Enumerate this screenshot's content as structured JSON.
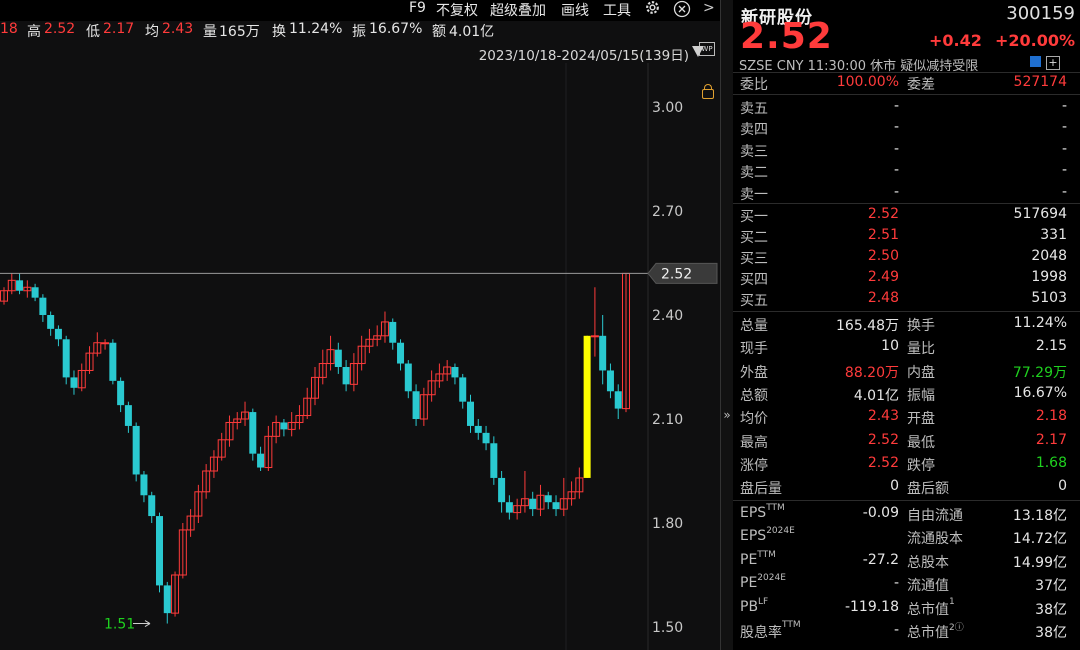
{
  "toolbar": {
    "f9": "F9",
    "adjust": "不复权",
    "overlay": "超级叠加",
    "draw": "画线",
    "tools": "工具",
    "next": ">"
  },
  "stats": {
    "partial_prefix": "18",
    "high_label": "高",
    "high": "2.52",
    "low_label": "低",
    "low": "2.17",
    "avg_label": "均",
    "avg": "2.43",
    "vol_label": "量",
    "vol": "165万",
    "turnover_label": "换",
    "turnover": "11.24%",
    "amplitude_label": "振",
    "amplitude": "16.67%",
    "amount_label": "额",
    "amount": "4.01亿"
  },
  "range_text": "2023/10/18-2024/05/15(139日)",
  "wp_label": "WP",
  "chart_data": {
    "type": "candlestick",
    "y_ticks": [
      3.0,
      2.7,
      2.4,
      2.1,
      1.8,
      1.5
    ],
    "y_tick_labels": [
      "3.00",
      "2.70",
      "2.40",
      "2.10",
      "1.80",
      "1.50"
    ],
    "ylim": [
      1.48,
      3.05
    ],
    "current_price_label": "2.52",
    "current_price": 2.52,
    "min_annotation": "1.51",
    "min_value": 1.51,
    "colors": {
      "up": "#ff3b3b",
      "down": "#2ac9d0",
      "limit_up": "#ffff00",
      "axis_text": "#c8c8c8"
    },
    "candles": [
      [
        2.44,
        2.47,
        2.43,
        2.48
      ],
      [
        2.47,
        2.5,
        2.46,
        2.52
      ],
      [
        2.5,
        2.47,
        2.46,
        2.52
      ],
      [
        2.47,
        2.48,
        2.45,
        2.5
      ],
      [
        2.48,
        2.45,
        2.44,
        2.49
      ],
      [
        2.45,
        2.4,
        2.38,
        2.46
      ],
      [
        2.4,
        2.36,
        2.34,
        2.41
      ],
      [
        2.36,
        2.33,
        2.31,
        2.37
      ],
      [
        2.33,
        2.22,
        2.2,
        2.34
      ],
      [
        2.22,
        2.19,
        2.17,
        2.24
      ],
      [
        2.19,
        2.24,
        2.18,
        2.26
      ],
      [
        2.24,
        2.29,
        2.23,
        2.31
      ],
      [
        2.29,
        2.32,
        2.28,
        2.35
      ],
      [
        2.32,
        2.32,
        2.3,
        2.33
      ],
      [
        2.32,
        2.21,
        2.2,
        2.33
      ],
      [
        2.21,
        2.14,
        2.12,
        2.22
      ],
      [
        2.14,
        2.08,
        2.06,
        2.15
      ],
      [
        2.08,
        1.94,
        1.92,
        2.09
      ],
      [
        1.94,
        1.88,
        1.86,
        1.95
      ],
      [
        1.88,
        1.82,
        1.8,
        1.89
      ],
      [
        1.82,
        1.62,
        1.6,
        1.83
      ],
      [
        1.62,
        1.54,
        1.51,
        1.63
      ],
      [
        1.54,
        1.65,
        1.53,
        1.66
      ],
      [
        1.65,
        1.78,
        1.64,
        1.8
      ],
      [
        1.78,
        1.82,
        1.76,
        1.84
      ],
      [
        1.82,
        1.89,
        1.8,
        1.91
      ],
      [
        1.89,
        1.95,
        1.87,
        1.97
      ],
      [
        1.95,
        1.99,
        1.93,
        2.01
      ],
      [
        1.99,
        2.04,
        1.98,
        2.06
      ],
      [
        2.04,
        2.09,
        2.02,
        2.11
      ],
      [
        2.09,
        2.1,
        2.07,
        2.12
      ],
      [
        2.1,
        2.12,
        2.08,
        2.15
      ],
      [
        2.12,
        2.0,
        1.98,
        2.13
      ],
      [
        2.0,
        1.96,
        1.95,
        2.02
      ],
      [
        1.96,
        2.05,
        1.95,
        2.08
      ],
      [
        2.05,
        2.09,
        2.03,
        2.11
      ],
      [
        2.09,
        2.07,
        2.05,
        2.1
      ],
      [
        2.07,
        2.09,
        2.05,
        2.12
      ],
      [
        2.09,
        2.11,
        2.07,
        2.14
      ],
      [
        2.11,
        2.16,
        2.1,
        2.19
      ],
      [
        2.16,
        2.22,
        2.14,
        2.25
      ],
      [
        2.22,
        2.26,
        2.2,
        2.3
      ],
      [
        2.26,
        2.3,
        2.24,
        2.34
      ],
      [
        2.3,
        2.25,
        2.23,
        2.32
      ],
      [
        2.25,
        2.2,
        2.18,
        2.27
      ],
      [
        2.2,
        2.26,
        2.18,
        2.29
      ],
      [
        2.26,
        2.31,
        2.24,
        2.34
      ],
      [
        2.31,
        2.33,
        2.29,
        2.36
      ],
      [
        2.33,
        2.34,
        2.31,
        2.37
      ],
      [
        2.34,
        2.38,
        2.32,
        2.41
      ],
      [
        2.38,
        2.32,
        2.3,
        2.39
      ],
      [
        2.32,
        2.26,
        2.24,
        2.33
      ],
      [
        2.26,
        2.18,
        2.16,
        2.27
      ],
      [
        2.18,
        2.1,
        2.08,
        2.2
      ],
      [
        2.1,
        2.17,
        2.08,
        2.19
      ],
      [
        2.17,
        2.21,
        2.15,
        2.24
      ],
      [
        2.21,
        2.23,
        2.19,
        2.26
      ],
      [
        2.23,
        2.25,
        2.21,
        2.27
      ],
      [
        2.25,
        2.22,
        2.2,
        2.26
      ],
      [
        2.22,
        2.15,
        2.13,
        2.23
      ],
      [
        2.15,
        2.08,
        2.06,
        2.17
      ],
      [
        2.08,
        2.06,
        2.04,
        2.1
      ],
      [
        2.06,
        2.03,
        2.01,
        2.08
      ],
      [
        2.03,
        1.93,
        1.91,
        2.05
      ],
      [
        1.93,
        1.86,
        1.83,
        1.95
      ],
      [
        1.86,
        1.83,
        1.81,
        1.88
      ],
      [
        1.83,
        1.85,
        1.81,
        1.87
      ],
      [
        1.85,
        1.87,
        1.83,
        1.95
      ],
      [
        1.87,
        1.84,
        1.82,
        1.89
      ],
      [
        1.84,
        1.88,
        1.82,
        1.91
      ],
      [
        1.88,
        1.86,
        1.84,
        1.89
      ],
      [
        1.86,
        1.84,
        1.82,
        1.88
      ],
      [
        1.84,
        1.87,
        1.82,
        1.93
      ],
      [
        1.87,
        1.89,
        1.85,
        1.92
      ],
      [
        1.89,
        1.93,
        1.87,
        1.96
      ],
      [
        1.93,
        2.34,
        1.93,
        2.34
      ],
      [
        2.34,
        2.34,
        2.28,
        2.48
      ],
      [
        2.34,
        2.24,
        2.2,
        2.4
      ],
      [
        2.24,
        2.18,
        2.16,
        2.26
      ],
      [
        2.18,
        2.13,
        2.1,
        2.2
      ],
      [
        2.13,
        2.52,
        2.12,
        2.52
      ]
    ]
  },
  "quote": {
    "name": "新研股份",
    "code": "300159",
    "price": "2.52",
    "change": "+0.42",
    "change_pct": "+20.00%",
    "status": "SZSE  CNY  11:30:00  休市  疑似减持受限",
    "weibi_label": "委比",
    "weibi": "100.00%",
    "weicha_label": "委差",
    "weicha": "527174",
    "asks": [
      {
        "label": "卖五",
        "price": "-",
        "vol": "-"
      },
      {
        "label": "卖四",
        "price": "-",
        "vol": "-"
      },
      {
        "label": "卖三",
        "price": "-",
        "vol": "-"
      },
      {
        "label": "卖二",
        "price": "-",
        "vol": "-"
      },
      {
        "label": "卖一",
        "price": "-",
        "vol": "-"
      }
    ],
    "bids": [
      {
        "label": "买一",
        "price": "2.52",
        "vol": "517694"
      },
      {
        "label": "买二",
        "price": "2.51",
        "vol": "331"
      },
      {
        "label": "买三",
        "price": "2.50",
        "vol": "2048"
      },
      {
        "label": "买四",
        "price": "2.49",
        "vol": "1998"
      },
      {
        "label": "买五",
        "price": "2.48",
        "vol": "5103"
      }
    ],
    "details": [
      {
        "l1": "总量",
        "v1": "165.48万",
        "c1": "white",
        "l2": "换手",
        "v2": "11.24%",
        "c2": "white"
      },
      {
        "l1": "现手",
        "v1": "10",
        "c1": "white",
        "l2": "量比",
        "v2": "2.15",
        "c2": "white"
      },
      {
        "l1": "外盘",
        "v1": "88.20万",
        "c1": "red",
        "l2": "内盘",
        "v2": "77.29万",
        "c2": "green"
      },
      {
        "l1": "总额",
        "v1": "4.01亿",
        "c1": "white",
        "l2": "振幅",
        "v2": "16.67%",
        "c2": "white"
      },
      {
        "l1": "均价",
        "v1": "2.43",
        "c1": "red",
        "l2": "开盘",
        "v2": "2.18",
        "c2": "red"
      },
      {
        "l1": "最高",
        "v1": "2.52",
        "c1": "red",
        "l2": "最低",
        "v2": "2.17",
        "c2": "red"
      },
      {
        "l1": "涨停",
        "v1": "2.52",
        "c1": "red",
        "l2": "跌停",
        "v2": "1.68",
        "c2": "green"
      },
      {
        "l1": "盘后量",
        "v1": "0",
        "c1": "white",
        "l2": "盘后额",
        "v2": "0",
        "c2": "white"
      }
    ],
    "fundamentals": [
      {
        "l1": "EPS",
        "s1": "TTM",
        "v1": "-0.09",
        "l2": "自由流通",
        "s2": "",
        "v2": "13.18亿"
      },
      {
        "l1": "EPS",
        "s1": "2024E",
        "v1": "",
        "l2": "流通股本",
        "s2": "",
        "v2": "14.72亿"
      },
      {
        "l1": "PE",
        "s1": "TTM",
        "v1": "-27.2",
        "l2": "总股本",
        "s2": "",
        "v2": "14.99亿"
      },
      {
        "l1": "PE",
        "s1": "2024E",
        "v1": "-",
        "l2": "流通值",
        "s2": "",
        "v2": "37亿"
      },
      {
        "l1": "PB",
        "s1": "LF",
        "v1": "-119.18",
        "l2": "总市值",
        "s2": "1",
        "v2": "38亿"
      },
      {
        "l1": "股息率",
        "s1": "TTM",
        "v1": "-",
        "l2": "总市值",
        "s2": "2ⓘ",
        "v2": "38亿"
      }
    ]
  }
}
